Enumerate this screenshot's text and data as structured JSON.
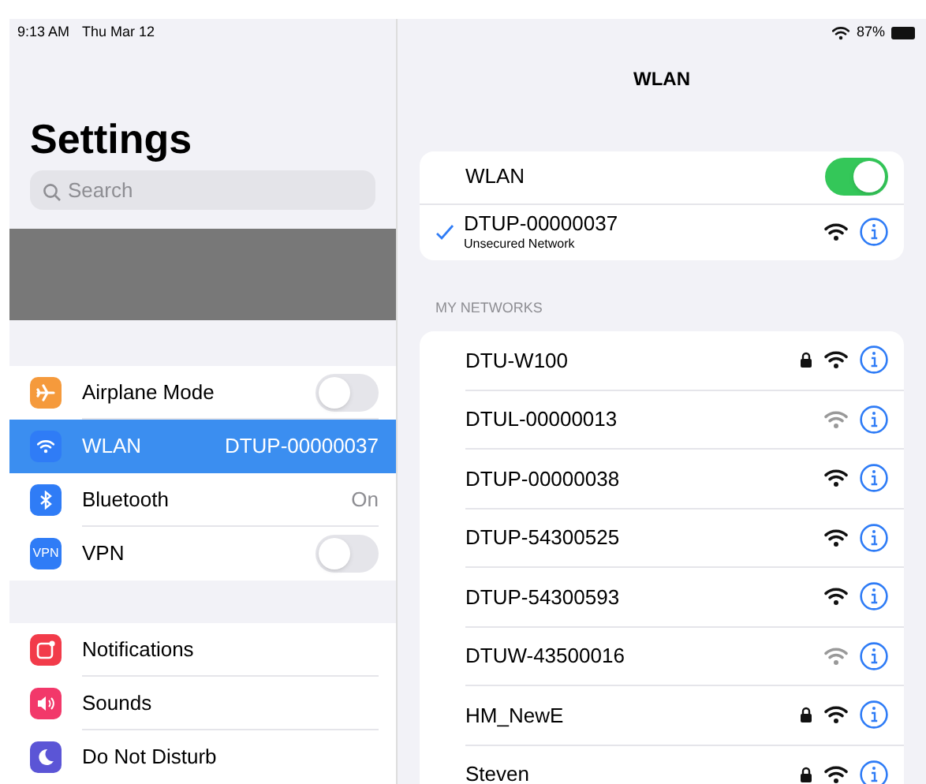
{
  "sidebar": {
    "status_time": "9:13 AM",
    "status_date": "Thu Mar 12",
    "title": "Settings",
    "search": {
      "placeholder": "Search"
    },
    "groups": [
      [
        {
          "label": "Airplane Mode",
          "kind": "airplane",
          "color": "#f59a3c",
          "on": false,
          "selected": false
        },
        {
          "label": "WLAN",
          "kind": "wifi",
          "color": "#2f7cf6",
          "value": "DTUP-00000037",
          "selected": true
        },
        {
          "label": "Bluetooth",
          "kind": "bluetooth",
          "color": "#2f7cf6",
          "value": "On",
          "selected": false
        },
        {
          "label": "VPN",
          "kind": "text",
          "icon_text": "VPN",
          "color": "#2f7cf6",
          "on": false,
          "selected": false
        }
      ],
      [
        {
          "label": "Notifications",
          "kind": "notifications",
          "color": "#f23b4a",
          "selected": false
        },
        {
          "label": "Sounds",
          "kind": "sounds",
          "color": "#f2386a",
          "selected": false
        },
        {
          "label": "Do Not Disturb",
          "kind": "moon",
          "color": "#5b55d6",
          "selected": false
        }
      ]
    ]
  },
  "detail": {
    "status_battery": "87%",
    "title": "WLAN",
    "wlan_label": "WLAN",
    "wlan_on": true,
    "current": {
      "name": "DTUP-00000037",
      "subtitle": "Unsecured Network",
      "connected": true,
      "locked": false,
      "weak": false
    },
    "section_header": "MY NETWORKS",
    "networks": [
      {
        "name": "DTU-W100",
        "locked": true,
        "weak": false
      },
      {
        "name": "DTUL-00000013",
        "locked": false,
        "weak": true
      },
      {
        "name": "DTUP-00000038",
        "locked": false,
        "weak": false
      },
      {
        "name": "DTUP-54300525",
        "locked": false,
        "weak": false
      },
      {
        "name": "DTUP-54300593",
        "locked": false,
        "weak": false
      },
      {
        "name": "DTUW-43500016",
        "locked": false,
        "weak": true
      },
      {
        "name": "HM_NewE",
        "locked": true,
        "weak": false
      },
      {
        "name": "Steven",
        "locked": true,
        "weak": false
      }
    ]
  }
}
